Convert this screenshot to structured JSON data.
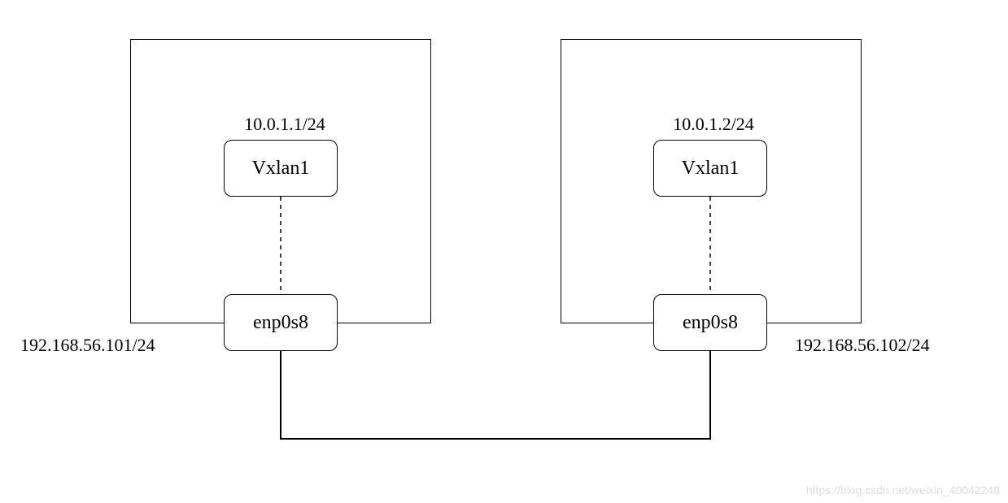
{
  "host1": {
    "vxlan": {
      "name": "Vxlan1",
      "ip": "10.0.1.1/24"
    },
    "nic": {
      "name": "enp0s8",
      "ip": "192.168.56.101/24"
    }
  },
  "host2": {
    "vxlan": {
      "name": "Vxlan1",
      "ip": "10.0.1.2/24"
    },
    "nic": {
      "name": "enp0s8",
      "ip": "192.168.56.102/24"
    }
  },
  "watermark": "https://blog.csdn.net/weixin_40042248"
}
